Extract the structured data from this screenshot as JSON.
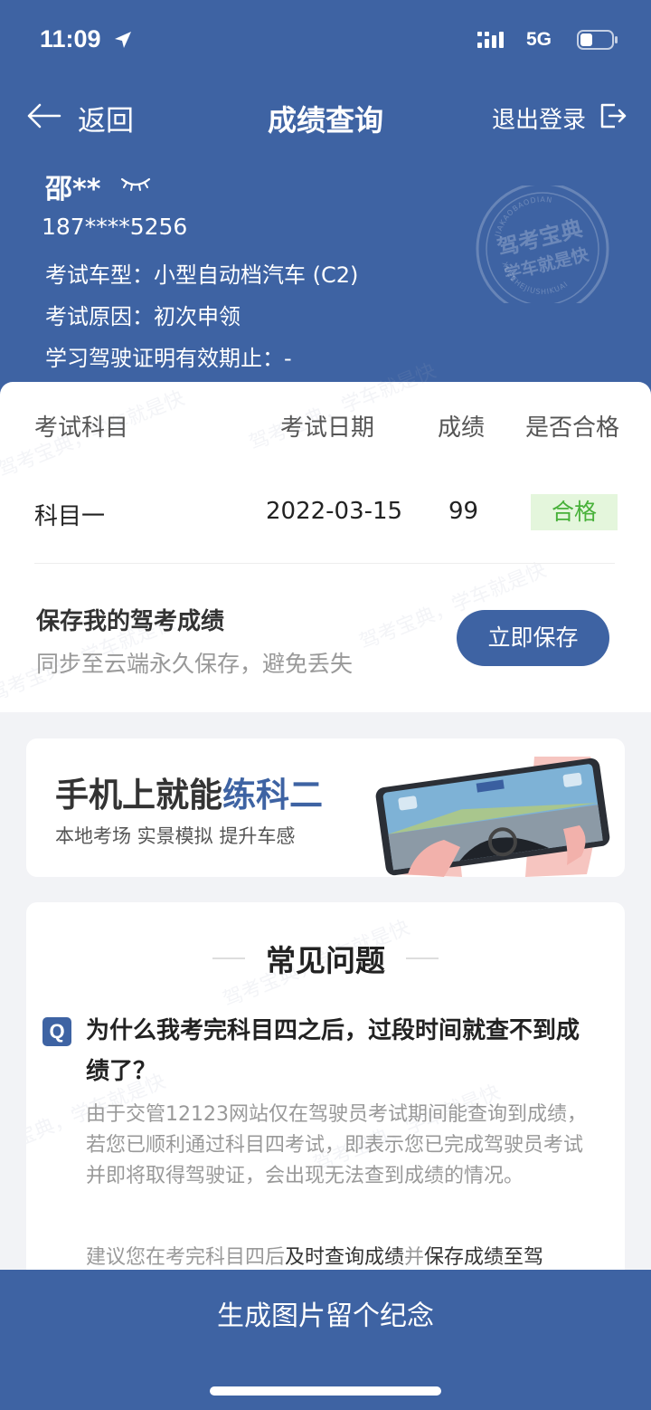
{
  "status_bar": {
    "time": "11:09",
    "network": "5G"
  },
  "nav": {
    "back_label": "返回",
    "title": "成绩查询",
    "logout_label": "退出登录"
  },
  "user": {
    "name": "邵**",
    "phone": "187****5256",
    "vehicle_type": "考试车型：小型自动档汽车 (C2)",
    "exam_reason": "考试原因：初次申领",
    "license_validity": "学习驾驶证明有效期止：-"
  },
  "stamp": {
    "brand": "驾考宝典",
    "slogan": "学车就是快",
    "pinyin_top": "JIAKAOBAODIAN",
    "pinyin_bottom": "XUECHEJIUSHIKUAI"
  },
  "results": {
    "headers": [
      "考试科目",
      "考试日期",
      "成绩",
      "是否合格"
    ],
    "rows": [
      {
        "subject": "科目一",
        "date": "2022-03-15",
        "score": "99",
        "passed": "合格"
      }
    ]
  },
  "save": {
    "title": "保存我的驾考成绩",
    "subtitle": "同步至云端永久保存，避免丢失",
    "button": "立即保存"
  },
  "banner": {
    "title_prefix": "手机上就能",
    "title_highlight": "练科二",
    "subtitle": "本地考场 实景模拟 提升车感"
  },
  "faq": {
    "title": "常见问题",
    "q_badge": "Q",
    "question": "为什么我考完科目四之后，过段时间就查不到成绩了？",
    "answer": "由于交管12123网站仅在驾驶员考试期间能查询到成绩，若您已顺利通过科目四考试，即表示您已完成驾驶员考试并即将取得驾驶证，会出现无法查到成绩的情况。",
    "answer2_a": "建议您在考完科目四后",
    "answer2_b": "及时查询成绩",
    "answer2_c": "并",
    "answer2_d": "保存成绩至驾"
  },
  "footer": {
    "button": "生成图片留个纪念"
  },
  "watermark": "驾考宝典，学车就是快",
  "colors": {
    "primary": "#3e63a3",
    "pass_bg": "#e4f6dc",
    "pass_text": "#48b13a"
  }
}
